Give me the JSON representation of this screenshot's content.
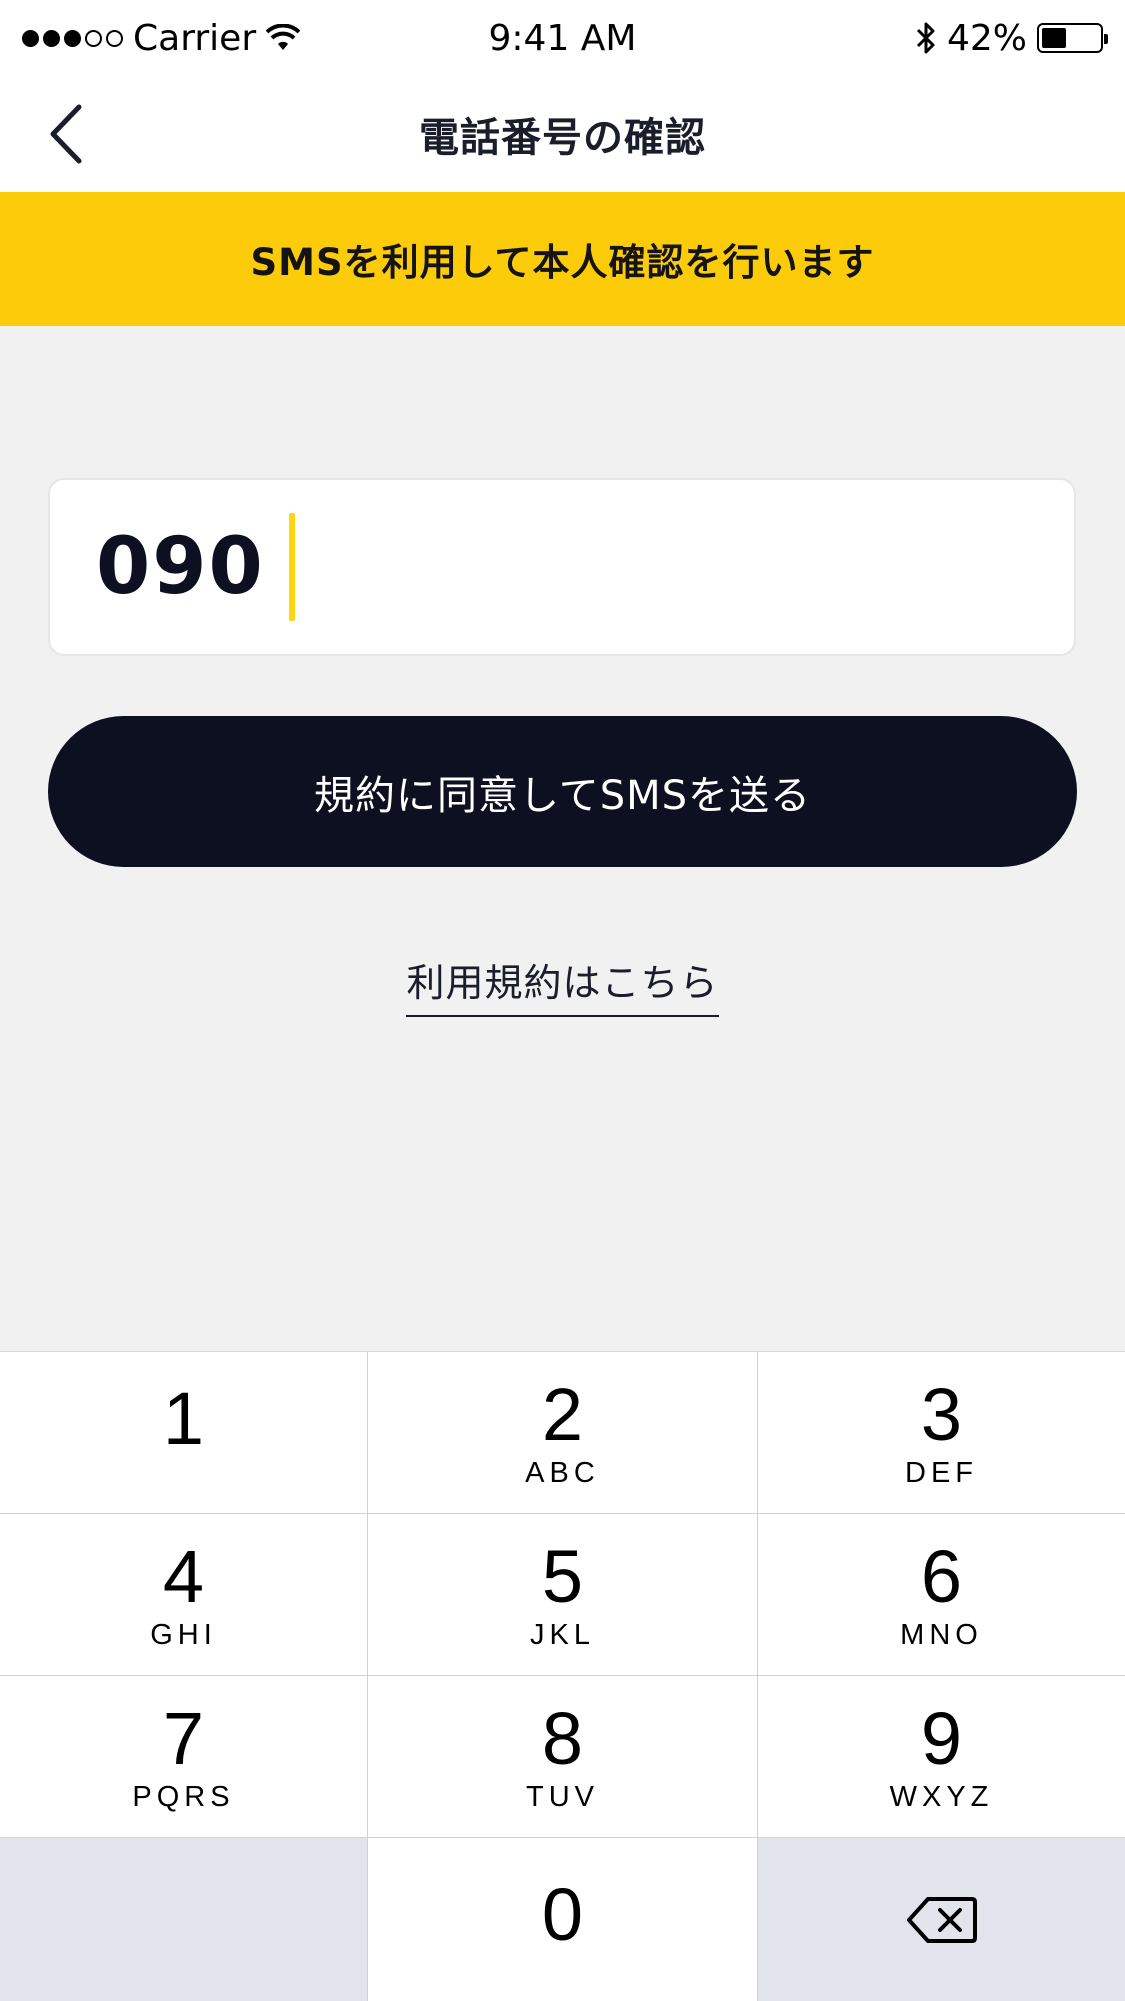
{
  "status_bar": {
    "carrier": "Carrier",
    "time": "9:41 AM",
    "battery_percent": "42%",
    "battery_level": 0.42
  },
  "nav": {
    "title": "電話番号の確認"
  },
  "banner": {
    "text": "SMSを利用して本人確認を行います"
  },
  "phone_input": {
    "value": "090"
  },
  "send_button": {
    "label": "規約に同意してSMSを送る"
  },
  "terms_link": {
    "label": "利用規約はこちら"
  },
  "keypad": {
    "keys": [
      {
        "digit": "1",
        "letters": ""
      },
      {
        "digit": "2",
        "letters": "ABC"
      },
      {
        "digit": "3",
        "letters": "DEF"
      },
      {
        "digit": "4",
        "letters": "GHI"
      },
      {
        "digit": "5",
        "letters": "JKL"
      },
      {
        "digit": "6",
        "letters": "MNO"
      },
      {
        "digit": "7",
        "letters": "PQRS"
      },
      {
        "digit": "8",
        "letters": "TUV"
      },
      {
        "digit": "9",
        "letters": "WXYZ"
      },
      {
        "digit": "0",
        "letters": ""
      }
    ]
  },
  "colors": {
    "accent_yellow": "#fccc0a",
    "dark_navy": "#0d1020",
    "background": "#f1f1f1"
  }
}
